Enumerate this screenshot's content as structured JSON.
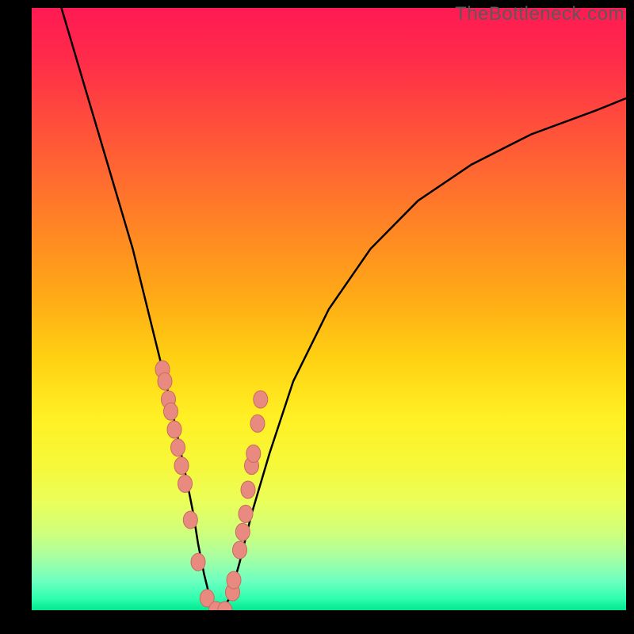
{
  "watermark": "TheBottleneck.com",
  "colors": {
    "frame": "#000000",
    "curve": "#000000",
    "marker_fill": "#e88a7f",
    "marker_stroke": "#c86a5f"
  },
  "chart_data": {
    "type": "line",
    "title": "",
    "xlabel": "",
    "ylabel": "",
    "xlim": [
      0,
      100
    ],
    "ylim": [
      0,
      100
    ],
    "grid": false,
    "legend": null,
    "annotations": [],
    "series": [
      {
        "name": "curve",
        "x": [
          5,
          8,
          11,
          14,
          17,
          19,
          21,
          23,
          24.5,
          26,
          27.2,
          28,
          29,
          30,
          31,
          32,
          33.3,
          35,
          37,
          40,
          44,
          50,
          57,
          65,
          74,
          84,
          95,
          100
        ],
        "values": [
          100,
          90,
          80,
          70,
          60,
          52,
          44,
          36,
          29,
          22,
          16,
          11,
          6,
          2,
          0,
          0,
          2,
          8,
          16,
          26,
          38,
          50,
          60,
          68,
          74,
          79,
          83,
          85
        ]
      }
    ],
    "markers": {
      "name": "data-points",
      "x": [
        22.0,
        22.4,
        23.0,
        23.4,
        24.0,
        24.6,
        25.2,
        25.8,
        26.7,
        28.0,
        29.5,
        31.0,
        32.5,
        33.8,
        34.0,
        35.0,
        35.5,
        36.0,
        36.4,
        37.0,
        37.3,
        38.0,
        38.5
      ],
      "values": [
        40,
        38,
        35,
        33,
        30,
        27,
        24,
        21,
        15,
        8,
        2,
        0,
        0,
        3,
        5,
        10,
        13,
        16,
        20,
        24,
        26,
        31,
        35
      ]
    }
  }
}
